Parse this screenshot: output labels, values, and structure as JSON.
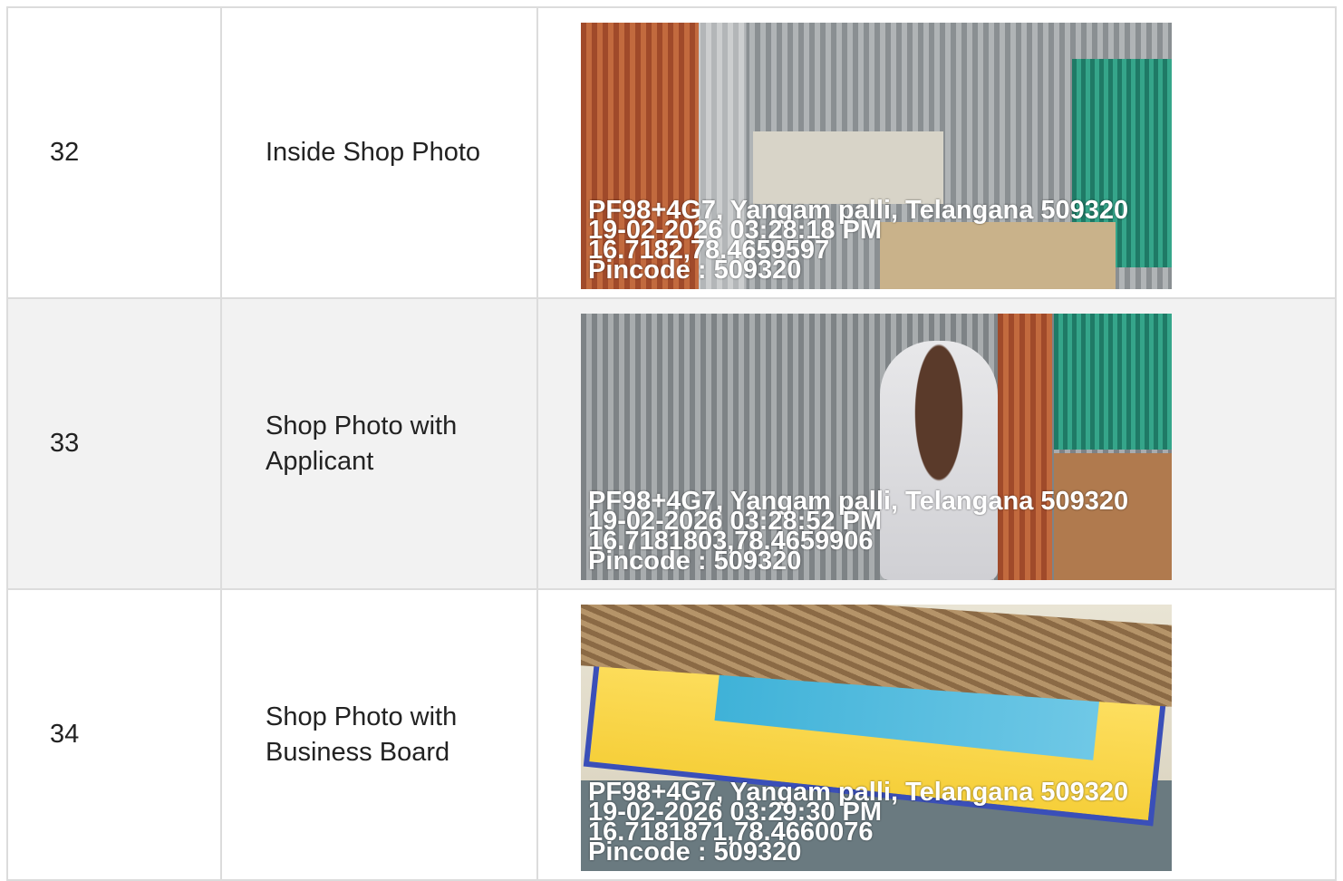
{
  "rows": [
    {
      "number": "32",
      "label": "Inside Shop Photo",
      "photo": {
        "address": "PF98+4G7, Yangam palli, Telangana 509320",
        "datetime": "19-02-2026 03:28:18 PM",
        "coords": "16.7182,78.4659597",
        "pincode": "Pincode : 509320"
      }
    },
    {
      "number": "33",
      "label": "Shop Photo with Applicant",
      "photo": {
        "address": "PF98+4G7, Yangam palli, Telangana 509320",
        "datetime": "19-02-2026 03:28:52 PM",
        "coords": "16.7181803,78.4659906",
        "pincode": "Pincode : 509320"
      }
    },
    {
      "number": "34",
      "label": "Shop Photo with Business Board",
      "photo": {
        "address": "PF98+4G7, Yangam palli, Telangana 509320",
        "datetime": "19-02-2026 03:29:30 PM",
        "coords": "16.7181871,78.4660076",
        "pincode": "Pincode : 509320"
      }
    }
  ]
}
